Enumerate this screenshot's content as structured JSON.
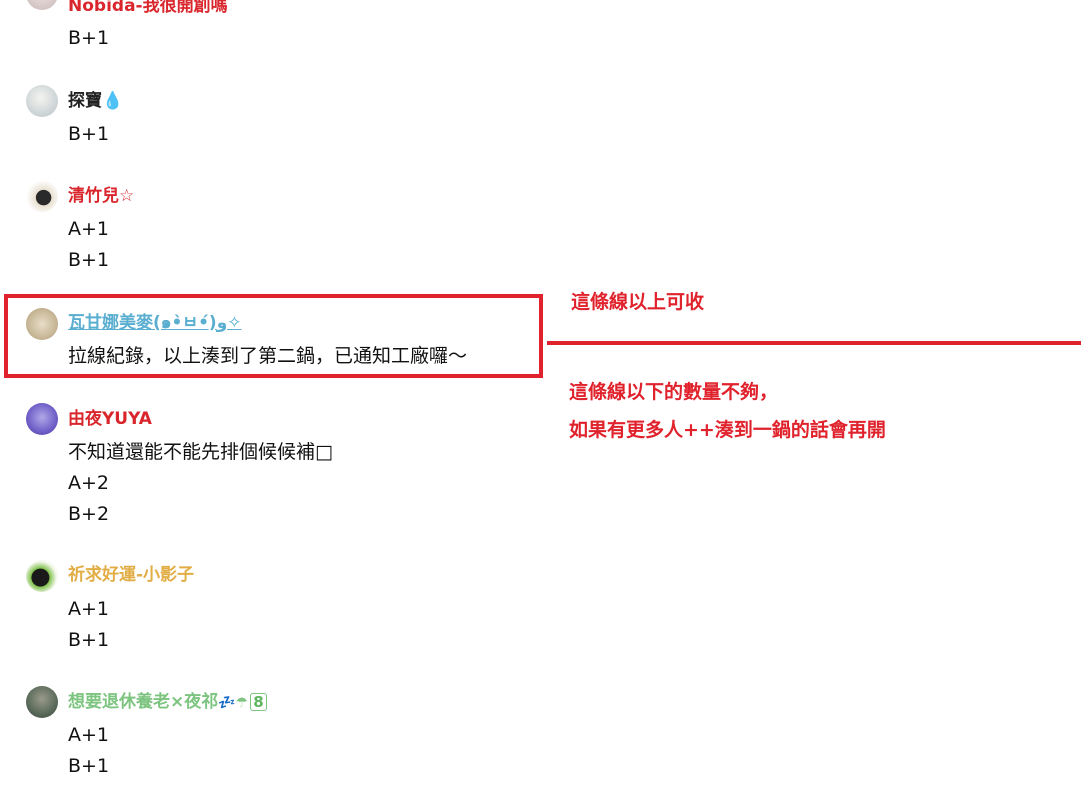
{
  "comments": [
    {
      "name": "Nobida-我很開創嗎",
      "name_color": "#d9262c",
      "lines": [
        "B+1"
      ]
    },
    {
      "name": "探寶💧",
      "name_color": "#222222",
      "lines": [
        "B+1"
      ]
    },
    {
      "name": "清竹兒☆",
      "name_color": "#d9262c",
      "lines": [
        "A+1",
        "B+1"
      ]
    },
    {
      "name": "瓦甘娜美麥(๑•̀ㅂ•́)و✧",
      "name_color": "#5aaed0",
      "lines": [
        "拉線紀錄，以上湊到了第二鍋，已通知工廠囉～"
      ]
    },
    {
      "name": "由夜YUYA",
      "name_color": "#d9262c",
      "lines": [
        "不知道還能不能先排個候候補□",
        "A+2",
        "B+2"
      ]
    },
    {
      "name": "祈求好運-小影子",
      "name_color": "#e2ad45",
      "lines": [
        "A+1",
        "B+1"
      ]
    },
    {
      "name": "想要退休養老×夜祁",
      "name_color": "#7cc47f",
      "name_suffix_icons": "💤☂",
      "name_badge": "8",
      "lines": [
        "A+1",
        "B+1"
      ]
    }
  ],
  "annotations": {
    "above_line": "這條線以上可收",
    "below_line_1": "這條線以下的數量不夠，",
    "below_line_2": "如果有更多人++湊到一鍋的話會再開"
  },
  "colors": {
    "annotation": "#e0222c"
  }
}
